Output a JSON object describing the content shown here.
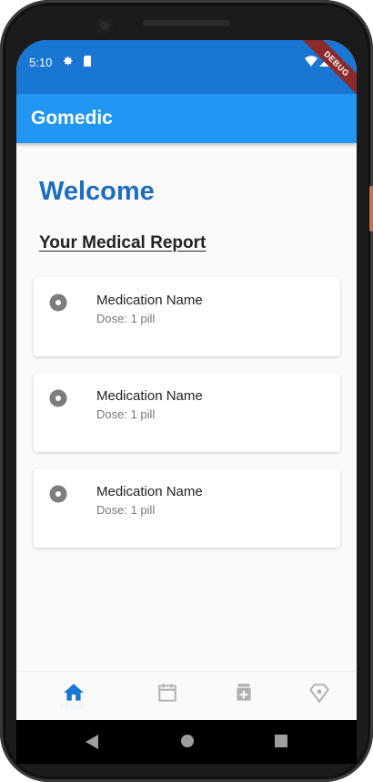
{
  "status_bar": {
    "time": "5:10",
    "debug_label": "DEBUG"
  },
  "app_bar": {
    "title": "Gomedic"
  },
  "main": {
    "welcome": "Welcome",
    "report_title": "Your Medical Report",
    "medications": [
      {
        "name": "Medication Name",
        "dose": "Dose: 1 pill"
      },
      {
        "name": "Medication Name",
        "dose": "Dose: 1 pill"
      },
      {
        "name": "Medication Name",
        "dose": "Dose: 1 pill"
      }
    ]
  },
  "bottom_nav": {
    "items": [
      {
        "icon": "home-icon",
        "label": "Home",
        "active": true
      },
      {
        "icon": "calendar-icon",
        "active": false
      },
      {
        "icon": "medicine-icon",
        "active": false
      },
      {
        "icon": "location-icon",
        "active": false
      }
    ]
  },
  "colors": {
    "status_bar": "#1976d2",
    "app_bar": "#2196f3",
    "welcome": "#1e6ec0",
    "nav_active": "#1976d2",
    "nav_inactive": "#b0b0b0"
  }
}
